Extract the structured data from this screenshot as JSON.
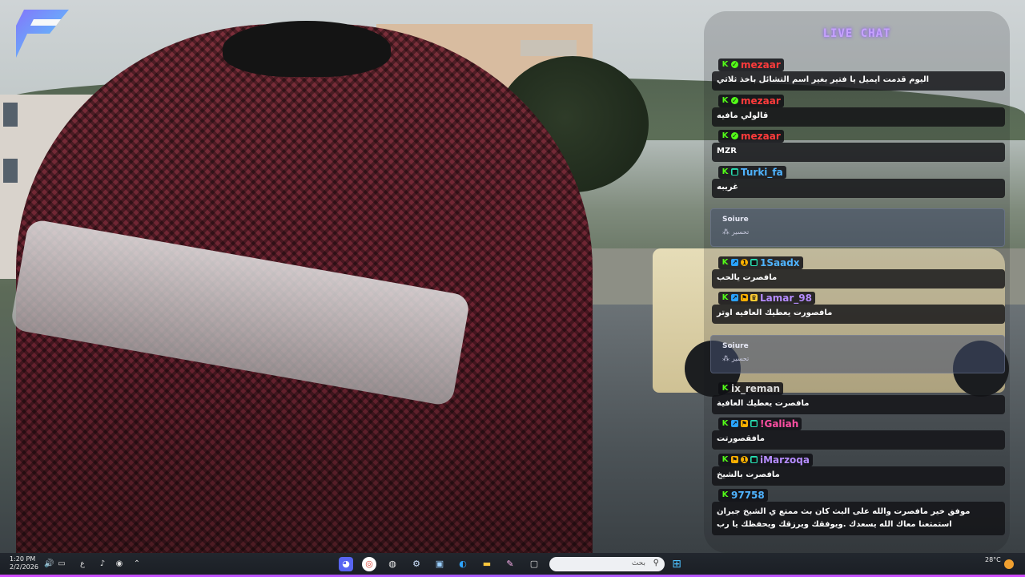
{
  "chat": {
    "title": "LIVE CHAT",
    "messages": [
      {
        "user": "mezaar",
        "color": "#ff3b3b",
        "badges": [
          "kick",
          "verified"
        ],
        "text": "اليوم قدمت ايميل يا فتير بغير اسم التشائل باخذ ثلاثي"
      },
      {
        "user": "mezaar",
        "color": "#ff3b3b",
        "badges": [
          "kick",
          "verified"
        ],
        "text": "قالولي مافيه"
      },
      {
        "user": "mezaar",
        "color": "#ff3b3b",
        "badges": [
          "kick",
          "verified"
        ],
        "text": "MZR"
      },
      {
        "user": "Turki_fa",
        "color": "#4fb3ff",
        "badges": [
          "kick",
          "gift"
        ],
        "text": "غريبه"
      },
      {
        "user": "1Saadx",
        "color": "#4fb3ff",
        "badges": [
          "kick",
          "sub",
          "star",
          "gift"
        ],
        "text": "مافصرت يالحب"
      },
      {
        "user": "Lamar_98",
        "color": "#b58cff",
        "badges": [
          "kick",
          "sub",
          "flag",
          "crown"
        ],
        "text": "مافصورت يعطيك العافيه اوتر"
      },
      {
        "user": "ix_reman",
        "color": "#dcdcdc",
        "badges": [
          "kick"
        ],
        "text": "مافصرت يعطيك العافية"
      },
      {
        "user": "!Galiah",
        "color": "#ff4fa3",
        "badges": [
          "kick",
          "sub",
          "flag",
          "gift"
        ],
        "text": "مافقصورتت"
      },
      {
        "user": "iMarzoqa",
        "color": "#b58cff",
        "badges": [
          "kick",
          "flag",
          "star",
          "gift"
        ],
        "text": "مافصرت بالشيخ"
      },
      {
        "user": "97758",
        "color": "#4fb3ff",
        "badges": [
          "kick"
        ],
        "text": "موفق خير مافصرت والله على البث  كان بث ممتع ي الشيخ جبران استمتعنا معاك الله يسعدك .ويوفقك ويرزقك ويحفظك يا رب"
      }
    ],
    "system_messages": [
      {
        "name": "Soiure",
        "text": "تحسير"
      },
      {
        "name": "Soiure",
        "text": "تحسير"
      }
    ]
  },
  "taskbar": {
    "time": "1:20 PM",
    "date": "2/2/2026",
    "search_label": "بحث",
    "weather": "28°C",
    "lang": "ع"
  },
  "colors": {
    "accent": "#a65cff",
    "kick": "#53fc18"
  }
}
